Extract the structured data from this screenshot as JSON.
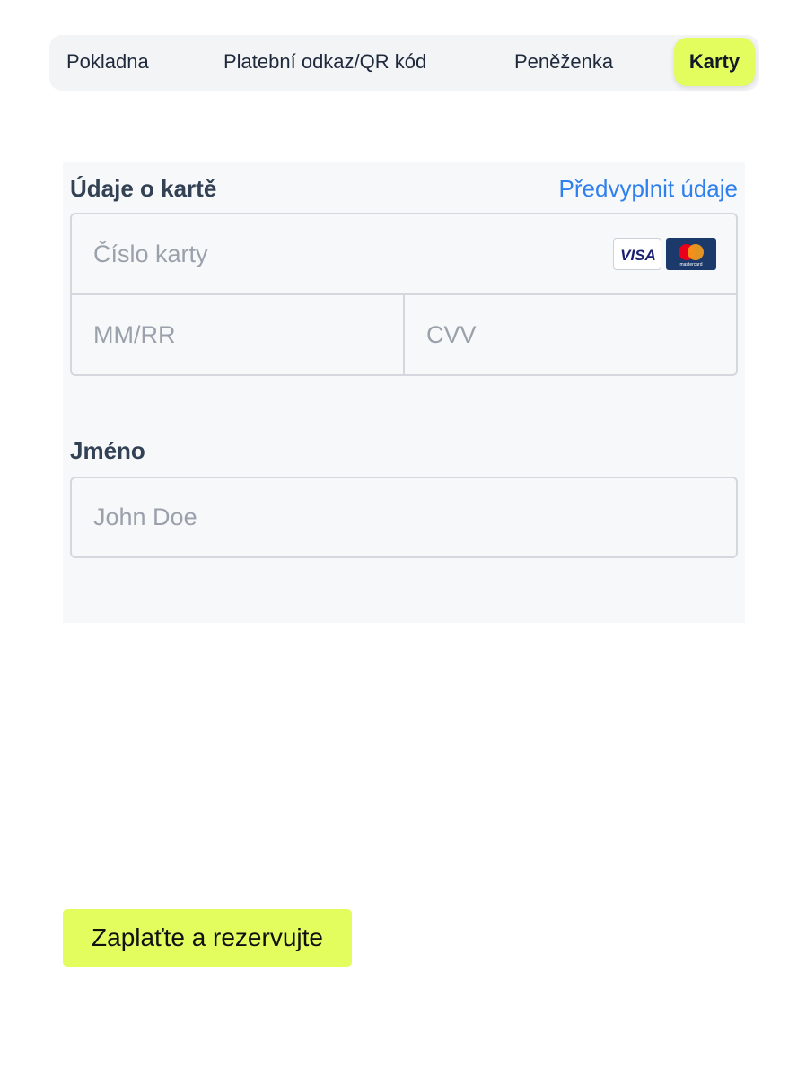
{
  "tabs": [
    {
      "label": "Pokladna"
    },
    {
      "label": "Platební odkaz/QR kód"
    },
    {
      "label": "Peněženka"
    },
    {
      "label": "Karty",
      "active": true
    }
  ],
  "card_section": {
    "title": "Údaje o kartě",
    "prefill_link": "Předvyplnit údaje",
    "card_number_placeholder": "Číslo karty",
    "expiry_placeholder": "MM/RR",
    "cvv_placeholder": "CVV",
    "card_brands": [
      {
        "icon": "visa-icon",
        "label": "VISA",
        "color": "#1a1f71"
      },
      {
        "icon": "mastercard-icon",
        "label": "mastercard",
        "colors": [
          "#eb001b",
          "#f79e1b"
        ]
      }
    ]
  },
  "name_section": {
    "label": "Jméno",
    "placeholder": "John Doe"
  },
  "pay_button": {
    "label": "Zaplaťte a rezervujte"
  },
  "colors": {
    "accent": "#e3fd5f",
    "link": "#2f80ed",
    "panel_bg": "#f7f8fa",
    "tab_bar_bg": "#f3f4f6"
  }
}
